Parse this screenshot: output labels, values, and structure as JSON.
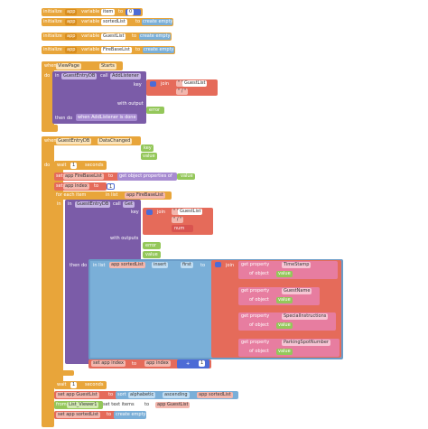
{
  "globals": [
    {
      "kw": "initialize",
      "scope": "app",
      "var": "variable",
      "name": "item",
      "to": "to",
      "val": "0"
    },
    {
      "kw": "initialize",
      "scope": "app",
      "var": "variable",
      "name": "sortedList",
      "to": "to",
      "val": "create empty list"
    },
    {
      "kw": "initialize",
      "scope": "app",
      "var": "variable",
      "name": "GuestList",
      "to": "to",
      "val": "create empty list"
    },
    {
      "kw": "initialize",
      "scope": "app",
      "var": "variable",
      "name": "FireBaseList",
      "to": "to",
      "val": "create empty list"
    }
  ],
  "event1": {
    "when": "when",
    "comp": "ViewPage",
    "evt": "Starts",
    "do": "do",
    "in": "in",
    "entry": "GuestEntryDB",
    "call": "call",
    "method": "AddListener",
    "key": "key",
    "join": "join",
    "path": "GuestList",
    "q1": "\" \"",
    "q2": "\" / \"",
    "withOutput": "with output",
    "error": "error",
    "thenDo": "then do",
    "status": "when AddListener is done"
  },
  "event2": {
    "when": "when",
    "comp": "GuestEntryDB",
    "evt": "DataChanged",
    "key": "key",
    "value": "value",
    "do": "do",
    "wait": "wait",
    "waitNum": "1",
    "seconds": "seconds",
    "set": "set",
    "fbList": "app FireBaseList",
    "to": "to",
    "getProps": "get object properties of",
    "valueLbl": "value",
    "appIndex": "app index",
    "one": "1",
    "forEach": "for each item",
    "inList": "in list",
    "list": "app FireBaseList",
    "in": "in",
    "entry": "GuestEntryDB",
    "call": "call",
    "get": "Get",
    "keyLbl": "key",
    "join": "join",
    "path": "GuestList",
    "q1": "\" \"",
    "q2": "\" / \"",
    "num": "num",
    "withOutputs": "with outputs",
    "error": "error",
    "value2": "value",
    "thenDo": "then do",
    "inList2": "in list",
    "sortedList": "app sortedList",
    "insert": "insert",
    "first": "first",
    "to2": "to",
    "join2": "join",
    "getProp": "get property",
    "ofObject": "of object",
    "fields": [
      "TimeStamp",
      "GuestName",
      "SpecialInstructions",
      "ParkingSpotNumber"
    ],
    "setIndex": "set app index",
    "toLbl": "to",
    "appIndex2": "app index",
    "plus": "+",
    "plusOne": "1"
  },
  "tail": {
    "wait": "wait",
    "waitNum": "1",
    "seconds": "seconds",
    "setGuest": "set app GuestList",
    "to": "to",
    "sort": "sort",
    "alpha": "alphabetic",
    "asc": "ascending",
    "sortedList": "app sortedList",
    "from": "from",
    "listView": "List_Viewer1",
    "set2": "set text items",
    "to2": "to",
    "guestList": "app GuestList",
    "set3": "set app sortedList",
    "to3": "to",
    "empty": "create empty list"
  }
}
